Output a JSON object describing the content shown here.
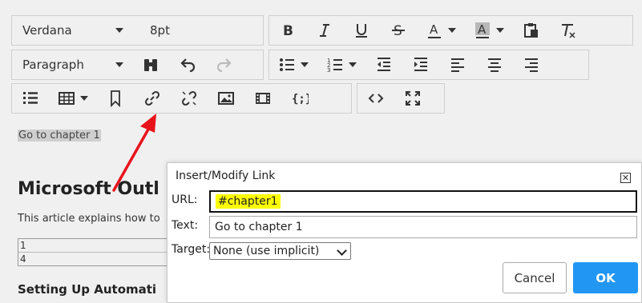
{
  "toolbar": {
    "font_family": "Verdana",
    "font_size": "8pt",
    "block_format": "Paragraph"
  },
  "editor": {
    "selected_link_text": "Go to chapter 1",
    "heading": "Microsoft Outl",
    "paragraph": "This article explains how to",
    "table_rows": [
      "1",
      "4"
    ],
    "subheading": "Setting Up Automati"
  },
  "dialog": {
    "title": "Insert/Modify Link",
    "url_label": "URL:",
    "url_value": "#chapter1",
    "text_label": "Text:",
    "text_value": "Go to chapter 1",
    "target_label": "Target:",
    "target_value": "None (use implicit)",
    "cancel_label": "Cancel",
    "ok_label": "OK"
  },
  "colors": {
    "accent": "#2196f3",
    "highlight": "#ffff00",
    "arrow": "#e8141c",
    "toolbar_bg": "#f0f0f0"
  }
}
